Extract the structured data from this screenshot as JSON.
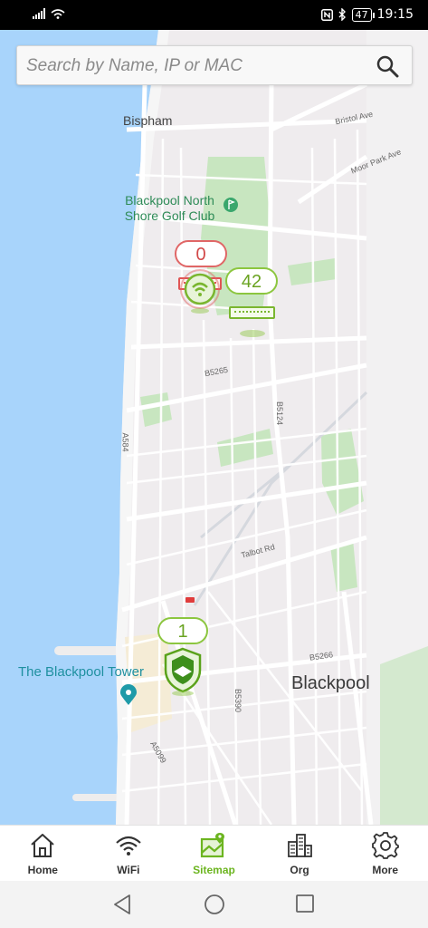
{
  "status_bar": {
    "battery": "47",
    "time": "19:15"
  },
  "search": {
    "placeholder": "Search by Name, IP or MAC"
  },
  "map": {
    "places": {
      "bispham": "Bispham",
      "golf_club": "Blackpool North Shore Golf Club",
      "tower": "The Blackpool Tower",
      "blackpool": "Blackpool"
    },
    "roads": {
      "bristol_ave": "Bristol Ave",
      "moor_park_ave": "Moor Park Ave",
      "b5265": "B5265",
      "b5124": "B5124",
      "a584": "A584",
      "talbot_rd": "Talbot Rd",
      "b5266": "B5266",
      "b5390": "B5390",
      "a5099": "A5099"
    },
    "markers": {
      "north_red_count": "0",
      "north_green_count": "42",
      "south_green_count": "1"
    }
  },
  "nav": {
    "items": [
      {
        "label": "Home",
        "icon": "home-icon",
        "active": false
      },
      {
        "label": "WiFi",
        "icon": "wifi-icon",
        "active": false
      },
      {
        "label": "Sitemap",
        "icon": "sitemap-icon",
        "active": true
      },
      {
        "label": "Org",
        "icon": "org-icon",
        "active": false
      },
      {
        "label": "More",
        "icon": "gear-icon",
        "active": false
      }
    ]
  },
  "colors": {
    "accent_green": "#6cb520",
    "alert_red": "#e06666",
    "water": "#a8d4fb",
    "park": "#c8e6c0"
  }
}
